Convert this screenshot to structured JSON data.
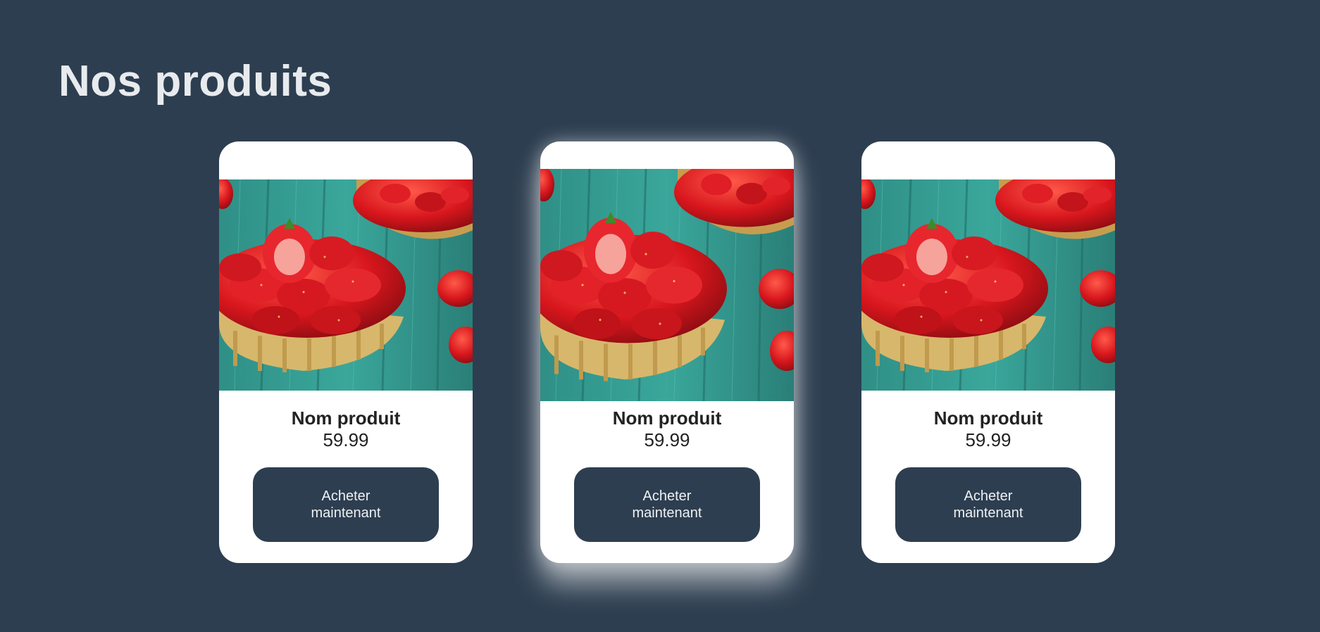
{
  "page": {
    "title": "Nos produits"
  },
  "products": [
    {
      "name": "Nom produit",
      "price": "59.99",
      "button_label": "Acheter maintenant",
      "image": "strawberry-tart-image"
    },
    {
      "name": "Nom produit",
      "price": "59.99",
      "button_label": "Acheter maintenant",
      "image": "strawberry-tart-image"
    },
    {
      "name": "Nom produit",
      "price": "59.99",
      "button_label": "Acheter maintenant",
      "image": "strawberry-tart-image"
    }
  ],
  "colors": {
    "background": "#2d3e50",
    "card": "#ffffff",
    "button": "#2d3e50",
    "title": "#e8ebee"
  }
}
